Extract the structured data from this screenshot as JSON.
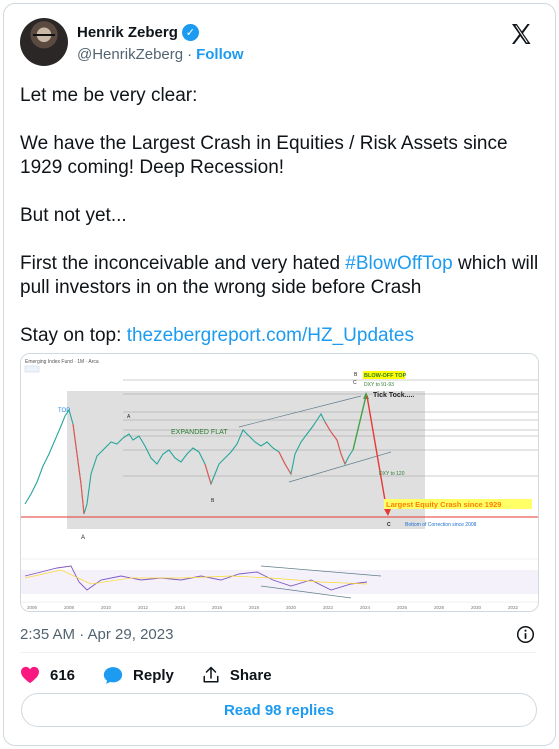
{
  "author": {
    "name": "Henrik Zeberg",
    "handle": "@HenrikZeberg",
    "separator": "·",
    "follow_label": "Follow",
    "verified": true
  },
  "tweet": {
    "line1": "Let me be very clear:",
    "line2": "We have the Largest Crash in Equities / Risk Assets since 1929 coming! Deep Recession!",
    "line3": "But not yet...",
    "line4_pre": "First the inconceivable and very hated ",
    "line4_hashtag": "#BlowOffTop",
    "line4_post": " which will pull investors in on the wrong side before Crash",
    "line5_pre": "Stay on top:  ",
    "line5_link": "thezebergreport.com/HZ_Updates"
  },
  "chart_image": {
    "header": "Emerging Index Fund · 1M · Arca",
    "labels": {
      "top": "TOP",
      "expanded_flat": "EXPANDED FLAT",
      "a_bottom": "A",
      "a_mid": "A",
      "b_mid": "B",
      "b_top": "B",
      "c_top": "C",
      "c_bottom": "C",
      "blow_off": "BLOW-OFF TOP",
      "dxy_low": "DXY to 91-93",
      "tick": "Tick Tock.....",
      "dxy_high": "DXY to 120",
      "crash": "Largest Equity Crash since 1929",
      "bottom": "Bottom of Correction since 2008"
    },
    "years": [
      "2006",
      "2008",
      "2010",
      "2012",
      "2014",
      "2016",
      "2018",
      "2020",
      "2022",
      "2024",
      "2026",
      "2028",
      "2030",
      "2032"
    ],
    "colors": {
      "candle_up": "#26a69a",
      "candle_down": "#ef5350",
      "shaded": "#d9d9d9",
      "blow_off_bg": "#ffff00",
      "crash_text": "#ff7f00",
      "crash_line": "#e53935",
      "bottom_text": "#1d6fd0",
      "label_blue": "#1e88e5",
      "label_green": "#2e7d32"
    }
  },
  "meta": {
    "timestamp": "2:35 AM · Apr 29, 2023"
  },
  "actions": {
    "likes": "616",
    "reply": "Reply",
    "share": "Share",
    "read_replies": "Read 98 replies"
  }
}
